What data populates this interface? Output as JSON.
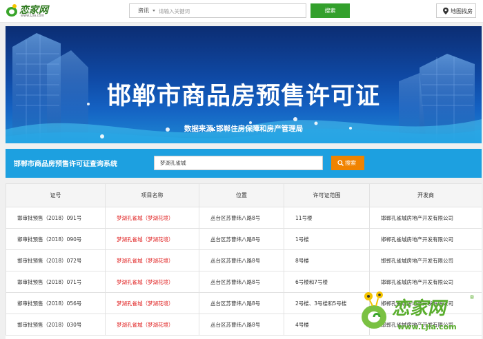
{
  "header": {
    "logo_text": "恋家网",
    "logo_sub": "www.Ljia.com",
    "search": {
      "category": "资讯",
      "placeholder": "请输入关键词",
      "button_label": "搜索"
    },
    "map_button_label": "地图找房"
  },
  "banner": {
    "title": "邯郸市商品房预售许可证",
    "source": "数据来源:邯郸住房保障和房产管理局"
  },
  "query": {
    "title": "邯郸市商品房预售许可证查询系统",
    "input_value": "梦湖孔雀城",
    "button_label": "搜索"
  },
  "table": {
    "headers": [
      "证号",
      "项目名称",
      "位置",
      "许可证范围",
      "开发商"
    ],
    "rows": [
      [
        "邯审批预售（2018）091号",
        "梦湖孔雀城（梦湖花境）",
        "丛台区苏曹纬八路8号",
        "11号楼",
        "邯郸孔雀城房地产开发有限公司"
      ],
      [
        "邯审批预售（2018）090号",
        "梦湖孔雀城（梦湖花境）",
        "丛台区苏曹纬八路8号",
        "1号楼",
        "邯郸孔雀城房地产开发有限公司"
      ],
      [
        "邯审批预售（2018）072号",
        "梦湖孔雀城（梦湖花境）",
        "丛台区苏曹纬八路8号",
        "8号楼",
        "邯郸孔雀城房地产开发有限公司"
      ],
      [
        "邯审批预售（2018）071号",
        "梦湖孔雀城（梦湖花境）",
        "丛台区苏曹纬八路8号",
        "6号楼和7号楼",
        "邯郸孔雀城房地产开发有限公司"
      ],
      [
        "邯审批预售（2018）056号",
        "梦湖孔雀城（梦湖花境）",
        "丛台区苏曹纬八路8号",
        "2号楼、3号楼和5号楼",
        "邯郸孔雀城房地产开发有限公司"
      ],
      [
        "邯审批预售（2018）030号",
        "梦湖孔雀城（梦湖花境）",
        "丛台区苏曹纬八路8号",
        "4号楼",
        "邯郸孔雀城房地产开发有限公司"
      ]
    ]
  },
  "watermark": {
    "text": "恋家网",
    "url": "www.Ljia.com",
    "registered": "®"
  },
  "colors": {
    "brand_green": "#33a02c",
    "query_blue": "#1da0e0",
    "search_orange": "#f08300",
    "project_red": "#e02020"
  },
  "icons": [
    "logo-mark-icon",
    "caret-down-icon",
    "map-pin-icon",
    "magnifier-icon"
  ]
}
